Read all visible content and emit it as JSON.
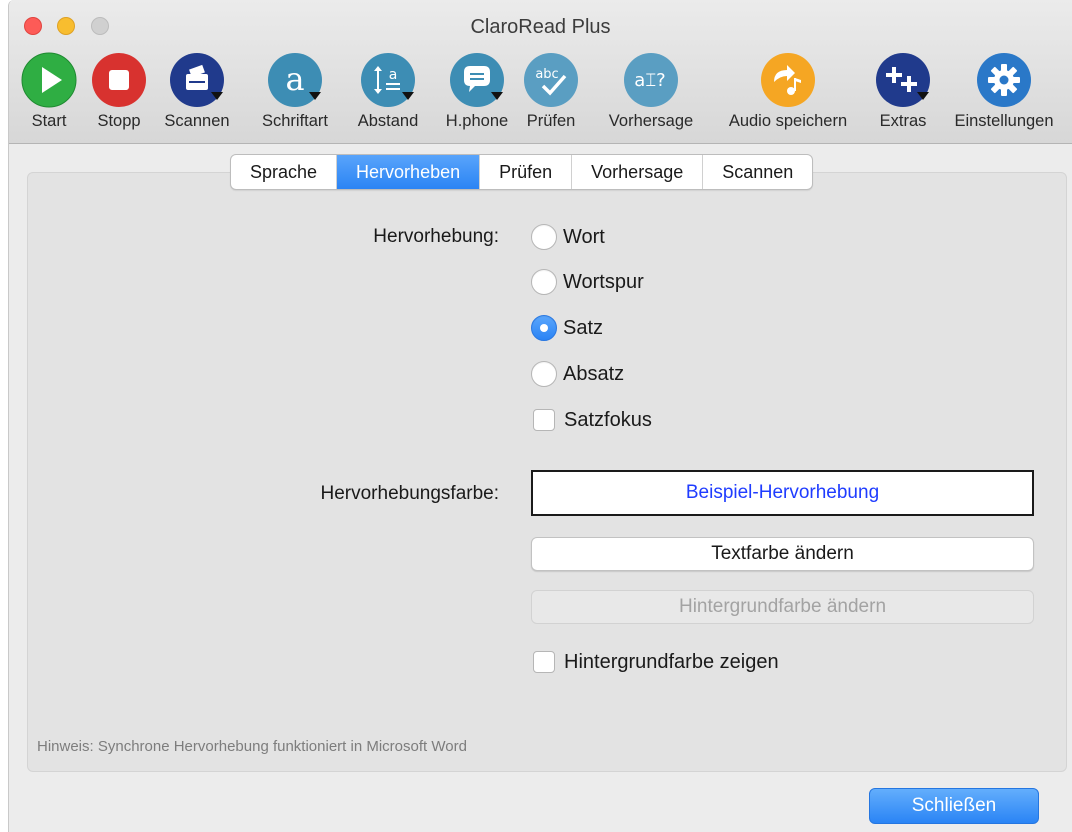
{
  "window": {
    "title": "ClaroRead Plus"
  },
  "toolbar": {
    "items": [
      {
        "label": "Start",
        "icon": "play-icon",
        "color": "#2aa63e"
      },
      {
        "label": "Stopp",
        "icon": "stop-icon",
        "color": "#d8322f"
      },
      {
        "label": "Scannen",
        "icon": "scanner-icon",
        "color": "#203a8c"
      },
      {
        "label": "Schriftart",
        "icon": "font-icon",
        "color": "#3d8db4"
      },
      {
        "label": "Abstand",
        "icon": "spacing-icon",
        "color": "#3d8db4"
      },
      {
        "label": "H.phone",
        "icon": "speech-bubble-icon",
        "color": "#3d8db4"
      },
      {
        "label": "Prüfen",
        "icon": "spellcheck-icon",
        "color": "#5a9ec2"
      },
      {
        "label": "Vorhersage",
        "icon": "prediction-icon",
        "color": "#5a9ec2"
      },
      {
        "label": "Audio speichern",
        "icon": "audio-save-icon",
        "color": "#f5a623"
      },
      {
        "label": "Extras",
        "icon": "extras-icon",
        "color": "#203a8c"
      },
      {
        "label": "Einstellungen",
        "icon": "gear-icon",
        "color": "#2a78c8"
      }
    ]
  },
  "tabs": [
    {
      "label": "Sprache",
      "active": false
    },
    {
      "label": "Hervorheben",
      "active": true
    },
    {
      "label": "Prüfen",
      "active": false
    },
    {
      "label": "Vorhersage",
      "active": false
    },
    {
      "label": "Scannen",
      "active": false
    }
  ],
  "highlight": {
    "label": "Hervorhebung:",
    "options": [
      {
        "label": "Wort",
        "checked": false
      },
      {
        "label": "Wortspur",
        "checked": false
      },
      {
        "label": "Satz",
        "checked": true
      },
      {
        "label": "Absatz",
        "checked": false
      }
    ],
    "sentence_focus": {
      "label": "Satzfokus",
      "checked": false
    }
  },
  "color": {
    "label": "Hervorhebungsfarbe:",
    "sample": "Beispiel-Hervorhebung",
    "text_color_button": "Textfarbe ändern",
    "background_color_button": "Hintergrundfarbe ändern",
    "show_background": {
      "label": "Hintergrundfarbe zeigen",
      "checked": false
    }
  },
  "hint": "Hinweis: Synchrone Hervorhebung funktioniert in Microsoft Word",
  "close_button": "Schließen",
  "colors": {
    "accent": "#2b84f4",
    "sample_text": "#1f3cff"
  }
}
